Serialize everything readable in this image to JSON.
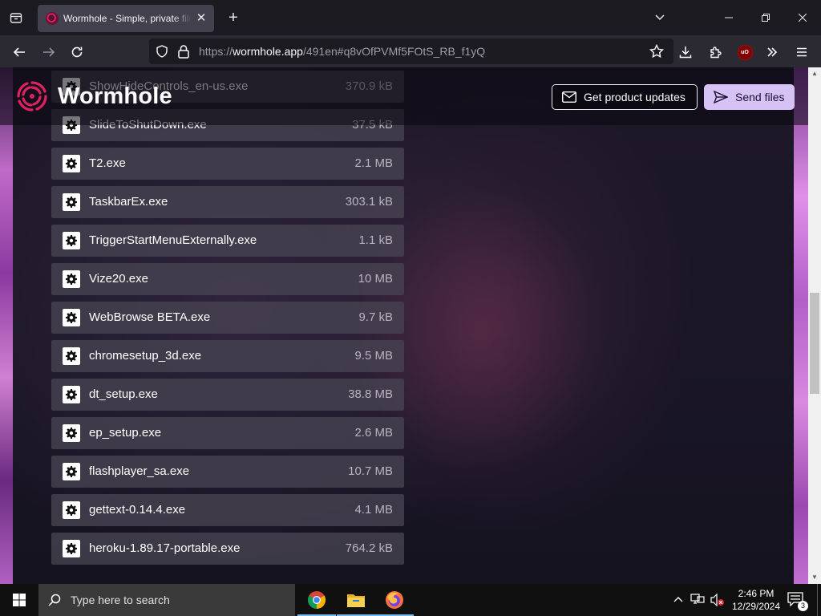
{
  "browser": {
    "tab_title": "Wormhole - Simple, private file sharing",
    "tab_close": "✕",
    "new_tab": "+",
    "url_prefix": "https://",
    "url_host": "wormhole.app",
    "url_path": "/491en#q8vOfPVMf5FOtS_RB_f1yQ"
  },
  "site": {
    "brand": "Wormhole",
    "brand_color": "#e02060",
    "updates_button": "Get product updates",
    "send_button": "Send files",
    "send_button_color": "#d6c2f5"
  },
  "files": [
    {
      "name": "ShowHideControls_en-us.exe",
      "size": "370.9 kB"
    },
    {
      "name": "SlideToShutDown.exe",
      "size": "37.5 kB"
    },
    {
      "name": "T2.exe",
      "size": "2.1 MB"
    },
    {
      "name": "TaskbarEx.exe",
      "size": "303.1 kB"
    },
    {
      "name": "TriggerStartMenuExternally.exe",
      "size": "1.1 kB"
    },
    {
      "name": "Vize20.exe",
      "size": "10 MB"
    },
    {
      "name": "WebBrowse BETA.exe",
      "size": "9.7 kB"
    },
    {
      "name": "chromesetup_3d.exe",
      "size": "9.5 MB"
    },
    {
      "name": "dt_setup.exe",
      "size": "38.8 MB"
    },
    {
      "name": "ep_setup.exe",
      "size": "2.6 MB"
    },
    {
      "name": "flashplayer_sa.exe",
      "size": "10.7 MB"
    },
    {
      "name": "gettext-0.14.4.exe",
      "size": "4.1 MB"
    },
    {
      "name": "heroku-1.89.17-portable.exe",
      "size": "764.2 kB"
    }
  ],
  "taskbar": {
    "search_placeholder": "Type here to search",
    "time": "2:46 PM",
    "date": "12/29/2024",
    "notification_count": "3",
    "apps": [
      "chrome-icon",
      "file-explorer-icon",
      "firefox-icon"
    ]
  }
}
